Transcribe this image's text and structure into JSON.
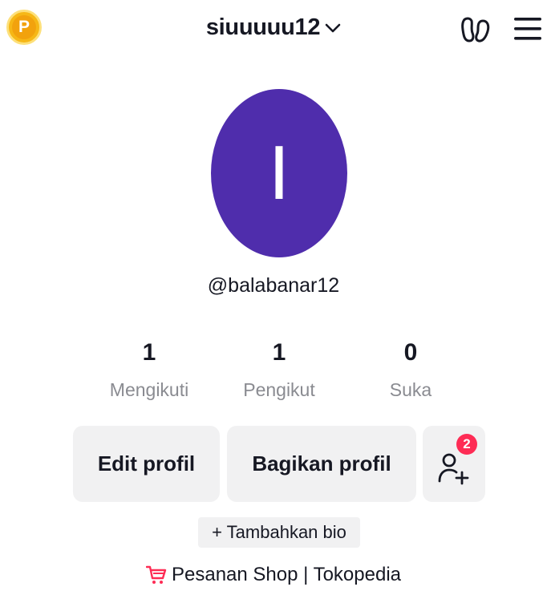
{
  "header": {
    "username": "siuuuuu12",
    "coin_letter": "P",
    "icons": [
      "coin-icon",
      "chevron-down-icon",
      "footprint-icon",
      "hamburger-menu-icon"
    ]
  },
  "profile": {
    "avatar_letter": "I",
    "avatar_color": "#4f2dac",
    "handle": "@balabanar12"
  },
  "stats": [
    {
      "value": "1",
      "label": "Mengikuti"
    },
    {
      "value": "1",
      "label": "Pengikut"
    },
    {
      "value": "0",
      "label": "Suka"
    }
  ],
  "actions": {
    "edit_label": "Edit profil",
    "share_label": "Bagikan profil",
    "friends_badge": "2"
  },
  "bio_label": "+ Tambahkan bio",
  "shop_label": "Pesanan Shop | Tokopedia",
  "colors": {
    "accent_red": "#fe2c55",
    "coin": "#f6b716",
    "button_bg": "#f1f1f2",
    "muted_text": "#8a8b91"
  }
}
